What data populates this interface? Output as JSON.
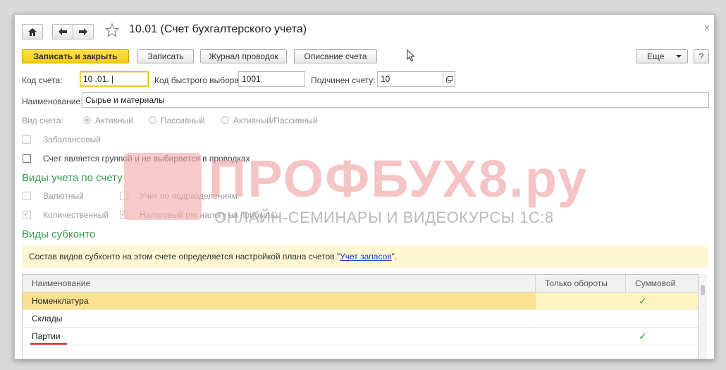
{
  "window": {
    "title": "10.01 (Счет бухгалтерского учета)",
    "close_glyph": "×"
  },
  "nav": {
    "home_icon": "home-icon",
    "back_icon": "arrow-left-icon",
    "forward_icon": "arrow-right-icon",
    "star_icon": "star-icon"
  },
  "toolbar": {
    "save_close_label": "Записать и закрыть",
    "save_label": "Записать",
    "journal_label": "Журнал проводок",
    "description_label": "Описание счета",
    "more_label": "Еще",
    "help_label": "?"
  },
  "form": {
    "code_label": "Код счета:",
    "code_value": "10 .01. |",
    "quick_code_label": "Код быстрого выбора:",
    "quick_code_value": "1001",
    "parent_label": "Подчинен счету:",
    "parent_value": "10",
    "name_label": "Наименование:",
    "name_value": "Сырье и материалы",
    "type_label": "Вид счета:",
    "type_options": [
      "Активный",
      "Пассивный",
      "Активный/Пассивный"
    ],
    "type_selected": "Активный",
    "offbalance_label": "Забалансовый",
    "group_label": "Счет является группой и не выбирается в проводках"
  },
  "accounting": {
    "section_title": "Виды учета по счету",
    "currency_label": "Валютный",
    "departments_label": "Учет по подразделениям",
    "quantity_label": "Количественный",
    "quantity_checked": true,
    "tax_label": "Налоговый (по налогу на прибыль)",
    "tax_checked": true
  },
  "subconto": {
    "section_title": "Виды субконто",
    "info_text": "Состав видов субконто на этом счете определяется настройкой плана счетов \"",
    "info_link": "Учет запасов",
    "info_end": "\".",
    "columns": [
      "Наименование",
      "Только обороты",
      "Суммовой"
    ],
    "rows": [
      {
        "name": "Номенклатура",
        "turnover_only": false,
        "sum": true,
        "selected": true
      },
      {
        "name": "Склады",
        "turnover_only": false,
        "sum": false,
        "selected": false
      },
      {
        "name": "Партии",
        "turnover_only": false,
        "sum": true,
        "selected": false
      }
    ],
    "check_glyph": "✓"
  },
  "watermark": {
    "brand": "ПРОФБУХ8.ру",
    "tagline": "ОНЛАЙН-СЕМИНАРЫ И ВИДЕОКУРСЫ 1С:8"
  },
  "colors": {
    "accent_green": "#2f9e4a",
    "primary_yellow": "#f5c915",
    "underline_red": "#d42020"
  }
}
